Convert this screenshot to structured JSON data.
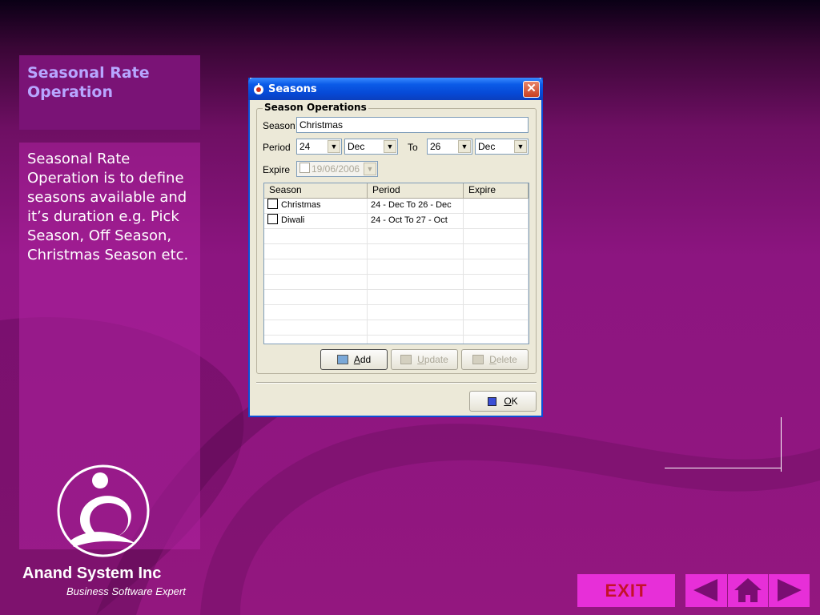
{
  "slide": {
    "title": "Seasonal Rate Operation",
    "description": "Seasonal Rate Operation is to define seasons available and it’s duration e.g. Pick Season, Off Season, Christmas Season etc.",
    "company_name": "Anand System Inc",
    "tagline": "Business Software Expert",
    "exit_label": "EXIT"
  },
  "window": {
    "title": "Seasons",
    "close_glyph": "✕",
    "group_label": "Season Operations",
    "season_label": "Season",
    "season_value": "Christmas",
    "period_label": "Period",
    "period_from_day": "24",
    "period_from_month": "Dec",
    "to_label": "To",
    "period_to_day": "26",
    "period_to_month": "Dec",
    "expire_label": "Expire",
    "expire_value": "19/06/2006",
    "list": {
      "columns": [
        "Season",
        "Period",
        "Expire"
      ],
      "rows": [
        {
          "season": "Christmas",
          "period": "24 - Dec To 26 - Dec",
          "expire": ""
        },
        {
          "season": "Diwali",
          "period": "24 - Oct To 27 - Oct",
          "expire": ""
        }
      ]
    },
    "buttons": {
      "add_prefix": "A",
      "add_rest": "dd",
      "update_prefix": "U",
      "update_rest": "pdate",
      "delete_prefix": "D",
      "delete_rest": "elete",
      "ok_prefix": "O",
      "ok_rest": "K"
    }
  },
  "colors": {
    "accent_title": "#b7a6ff",
    "window_titlebar": "#0b5be8",
    "exit_bg": "#e72fd8",
    "exit_text": "#c4112a"
  }
}
